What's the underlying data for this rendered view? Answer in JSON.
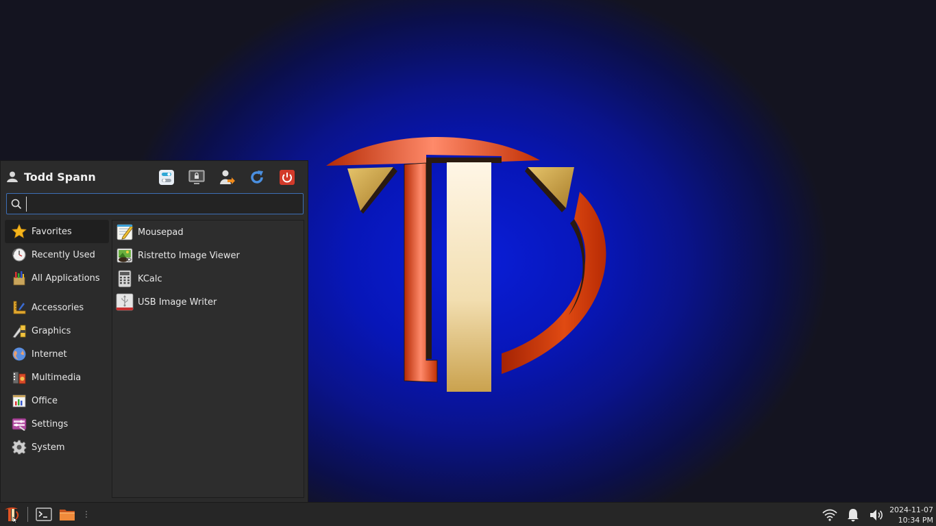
{
  "menu": {
    "user_name": "Todd Spann",
    "header_actions": [
      {
        "name": "settings-manager-button",
        "icon": "toggle-settings-icon"
      },
      {
        "name": "lock-screen-button",
        "icon": "lock-screen-icon"
      },
      {
        "name": "switch-user-button",
        "icon": "switch-user-icon"
      },
      {
        "name": "restart-button",
        "icon": "refresh-icon"
      },
      {
        "name": "logout-button",
        "icon": "power-icon"
      }
    ],
    "search": {
      "value": "",
      "placeholder": ""
    },
    "categories_top": [
      {
        "label": "Favorites",
        "icon": "star-icon"
      },
      {
        "label": "Recently Used",
        "icon": "clock-icon"
      },
      {
        "label": "All Applications",
        "icon": "all-applications-icon"
      }
    ],
    "categories": [
      {
        "label": "Accessories",
        "icon": "accessories-icon"
      },
      {
        "label": "Graphics",
        "icon": "graphics-icon"
      },
      {
        "label": "Internet",
        "icon": "globe-icon"
      },
      {
        "label": "Multimedia",
        "icon": "multimedia-icon"
      },
      {
        "label": "Office",
        "icon": "office-icon"
      },
      {
        "label": "Settings",
        "icon": "settings-icon"
      },
      {
        "label": "System",
        "icon": "gear-icon"
      }
    ],
    "apps": [
      {
        "label": "Mousepad",
        "icon": "text-editor-icon"
      },
      {
        "label": "Ristretto Image Viewer",
        "icon": "image-viewer-icon"
      },
      {
        "label": "KCalc",
        "icon": "calculator-icon"
      },
      {
        "label": "USB Image Writer",
        "icon": "usb-icon"
      }
    ]
  },
  "taskbar": {
    "launchers": [
      {
        "name": "terminal-launcher",
        "icon": "terminal-icon"
      },
      {
        "name": "file-manager-launcher",
        "icon": "folder-icon"
      }
    ],
    "tray": [
      "wifi-icon",
      "bell-icon",
      "volume-icon"
    ],
    "clock": {
      "date": "2024-11-07",
      "time": "10:34 PM"
    }
  },
  "colors": {
    "menu_bg": "#2b2b2b",
    "search_border": "#3d6fb8",
    "taskbar_bg": "#262626",
    "power_red": "#d23a2a",
    "refresh_blue": "#4a8fe0"
  }
}
